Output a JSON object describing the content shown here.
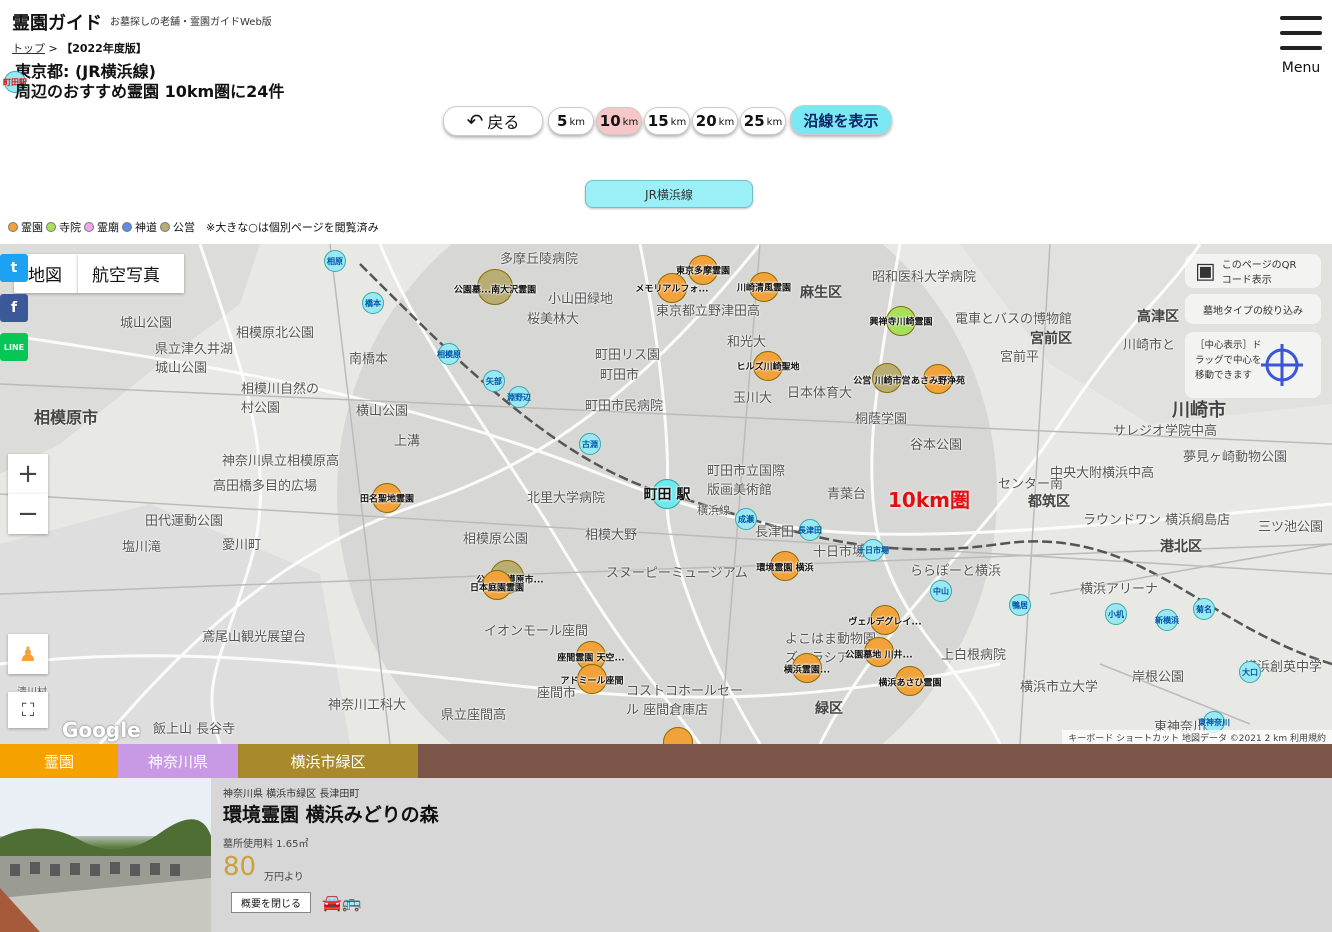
{
  "header": {
    "site_title": "霊園ガイド",
    "tagline": "お墓探しの老舗・霊園ガイドWeb版",
    "breadcrumb_home": "トップ",
    "breadcrumb_sep": ">",
    "breadcrumb_current": "【2022年度版】",
    "heading_pref": "東京都:",
    "heading_station": "町田駅",
    "heading_line": "(JR横浜線)",
    "heading_sub": "周辺のおすすめ霊園 10km圏に24件",
    "menu_label": "Menu"
  },
  "controls": {
    "back_label": "戻る",
    "radius_unit": "km",
    "radii": [
      "5",
      "10",
      "15",
      "20",
      "25"
    ],
    "selected_radius": "10",
    "show_line_label": "沿線を表示",
    "line_button_label": "JR横浜線"
  },
  "legend": {
    "items": [
      {
        "label": "霊園",
        "color": "#f2a23a"
      },
      {
        "label": "寺院",
        "color": "#a6e05a"
      },
      {
        "label": "霊廟",
        "color": "#f2a6ee"
      },
      {
        "label": "神道",
        "color": "#5b8ee6"
      },
      {
        "label": "公営",
        "color": "#b8ad72"
      }
    ],
    "note": "※大きな○は個別ページを閲覧済み"
  },
  "map": {
    "map_type_map": "地図",
    "map_type_aerial": "航空写真",
    "zoom_in": "+",
    "zoom_out": "−",
    "social": {
      "twitter": "t",
      "facebook": "f",
      "line": "LINE"
    },
    "qr_label": "このページのQRコード表示",
    "filter_label": "墓地タイプの絞り込み",
    "center_help": "［中心表示］ドラッグで中心を移動できます",
    "radius_label": "10km圏",
    "center_station": "町田 駅",
    "google": "Google",
    "attribution": "キーボード ショートカット  地図データ ©2021  2 km  利用規約",
    "cemeteries": [
      {
        "label": "東京多摩霊園",
        "type": "reien"
      },
      {
        "label": "メモリアルフォ...",
        "type": "reien"
      },
      {
        "label": "川崎清風霊園",
        "type": "reien"
      },
      {
        "label": "公園墓...南大沢霊園",
        "type": "koei"
      },
      {
        "label": "興禅寺川崎霊園",
        "type": "jiin"
      },
      {
        "label": "ヒルズ川崎聖地",
        "type": "reien"
      },
      {
        "label": "公営 川崎市営...",
        "type": "koei"
      },
      {
        "label": "あさみ野浄苑",
        "type": "reien"
      },
      {
        "label": "田名聖地霊園",
        "type": "reien"
      },
      {
        "label": "公営 相模原市...",
        "type": "koei"
      },
      {
        "label": "日本庭園霊園",
        "type": "reien"
      },
      {
        "label": "環境霊園 横浜",
        "type": "reien"
      },
      {
        "label": "ヴェルデグレイ...",
        "type": "reien"
      },
      {
        "label": "公園墓地 川井...",
        "type": "reien"
      },
      {
        "label": "横浜あさひ霊園",
        "type": "reien"
      },
      {
        "label": "横浜霊園...",
        "type": "reien"
      },
      {
        "label": "座間霊園 天空...",
        "type": "reien"
      },
      {
        "label": "アドミール座間",
        "type": "reien"
      }
    ],
    "stations": [
      "相原",
      "橋本",
      "相模原",
      "矢部",
      "淵野辺",
      "古淵",
      "成瀬",
      "長津田",
      "十日市場",
      "中山",
      "鴨居",
      "小机",
      "新横浜",
      "菊名",
      "大口",
      "東神奈川"
    ],
    "places": [
      "多摩丘陵病院",
      "小山田緑地",
      "桜美林大",
      "城山公園",
      "相模原北公園",
      "県立津久井湖城山公園",
      "相模川自然の村公園",
      "相模原市",
      "南橋本",
      "横山公園",
      "上溝",
      "神奈川県立相模原高",
      "高田橋多目的広場",
      "田代運動公園",
      "塩川滝",
      "愛川町",
      "鳶尾山観光展望台",
      "清川村",
      "神奈川工科大",
      "飯上山 長谷寺",
      "町田リス園",
      "町田市",
      "町田市民病院",
      "町田市立国際版画美術館",
      "北里大学病院",
      "相模原公園",
      "相模大野",
      "スヌーピーミュージアム",
      "座間市",
      "県立座間高",
      "イオンモール座間",
      "コストコホールセール 座間倉庫店",
      "東京都立野津田高",
      "和光大",
      "玉川大",
      "日本体育大",
      "桐蔭学園",
      "谷本公園",
      "青葉台",
      "横浜線",
      "長津田",
      "十日市場",
      "ららぽーと横浜",
      "よこはま動物園ズーラシア",
      "上白根病院",
      "麻生区",
      "電車とバスの博物館",
      "宮前区",
      "高津区",
      "川崎市",
      "昭和医科大学病院",
      "川崎市と",
      "サレジオ学院中高",
      "夢見ヶ崎動物公園",
      "中央大附横浜中高",
      "センター南",
      "都筑区",
      "ラウンドワン 横浜綱島店",
      "三ツ池公園",
      "港北区",
      "横浜アリーナ",
      "岸根公園",
      "横浜市立大学",
      "横浜創英中学",
      "東神奈川",
      "緑区",
      "宮前平"
    ]
  },
  "bottom": {
    "tab_reien": "霊園",
    "tab_pref": "神奈川県",
    "tab_ward": "横浜市緑区",
    "address": "神奈川県 横浜市緑区 長津田町",
    "name": "環境霊園 横浜みどりの森",
    "area": "墓所使用料 1.65㎡",
    "price": "80",
    "price_unit": "万円より",
    "close_label": "概要を閉じる",
    "transit_icons": "🚘🚌"
  }
}
